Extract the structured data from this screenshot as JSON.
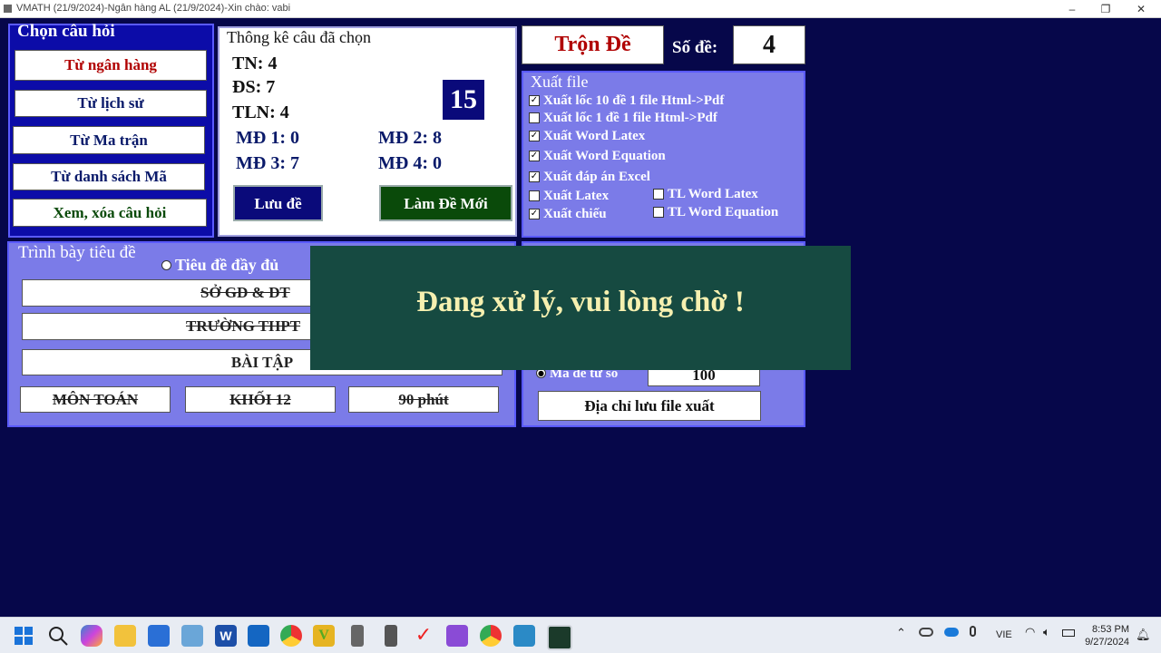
{
  "window": {
    "title": "VMATH (21/9/2024)-Ngân hàng AL (21/9/2024)-Xin chào: vabi"
  },
  "chon_cau_hoi": {
    "title": "Chọn câu hỏi",
    "items": [
      "Từ ngân hàng",
      "Từ lịch sử",
      "Từ Ma trận",
      "Từ danh sách Mã",
      "Xem, xóa câu hỏi"
    ]
  },
  "thong_ke": {
    "title": "Thông kê câu đã chọn",
    "tn": "TN: 4",
    "ds": "ĐS: 7",
    "tln": "TLN: 4",
    "total": "15",
    "md1": "MĐ 1: 0",
    "md2": "MĐ 2: 8",
    "md3": "MĐ 3: 7",
    "md4": "MĐ 4: 0",
    "save_label": "Lưu đề",
    "new_label": "Làm Đề Mới"
  },
  "tron_de": {
    "label": "Trộn Đề",
    "so_de_label": "Số đề:",
    "so_de_value": "4"
  },
  "xuat_file": {
    "title": "Xuất file",
    "options": [
      {
        "label": "Xuất lốc 10 đề 1 file Html->Pdf",
        "checked": true
      },
      {
        "label": "Xuất lốc 1 đề 1 file Html->Pdf",
        "checked": false
      },
      {
        "label": "Xuất Word Latex",
        "checked": true
      },
      {
        "label": "Xuất Word Equation",
        "checked": true
      },
      {
        "label": "Xuất đáp án Excel",
        "checked": true
      },
      {
        "label": "Xuất Latex",
        "checked": false
      },
      {
        "label": "Xuất chiếu",
        "checked": true
      },
      {
        "label": "TL Word Latex",
        "checked": false
      },
      {
        "label": "TL Word Equation",
        "checked": false
      }
    ]
  },
  "trinh_bay": {
    "title": "Trình bày tiêu đề",
    "radio_label": "Tiêu đề đầy đủ",
    "line1": "SỞ GD & ĐT",
    "line2": "TRƯỜNG THPT",
    "line3": "BÀI TẬP",
    "mon": "MÔN TOÁN",
    "khoi": "KHỐI 12",
    "time": "90 phút"
  },
  "ma_de": {
    "label": "Mã đề từ số",
    "value": "100",
    "folder_button": "Địa chỉ lưu file xuất"
  },
  "overlay": {
    "message": "Đang xử lý, vui lòng chờ !"
  },
  "taskbar": {
    "lang": "VIE",
    "time": "8:53 PM",
    "date": "9/27/2024"
  }
}
